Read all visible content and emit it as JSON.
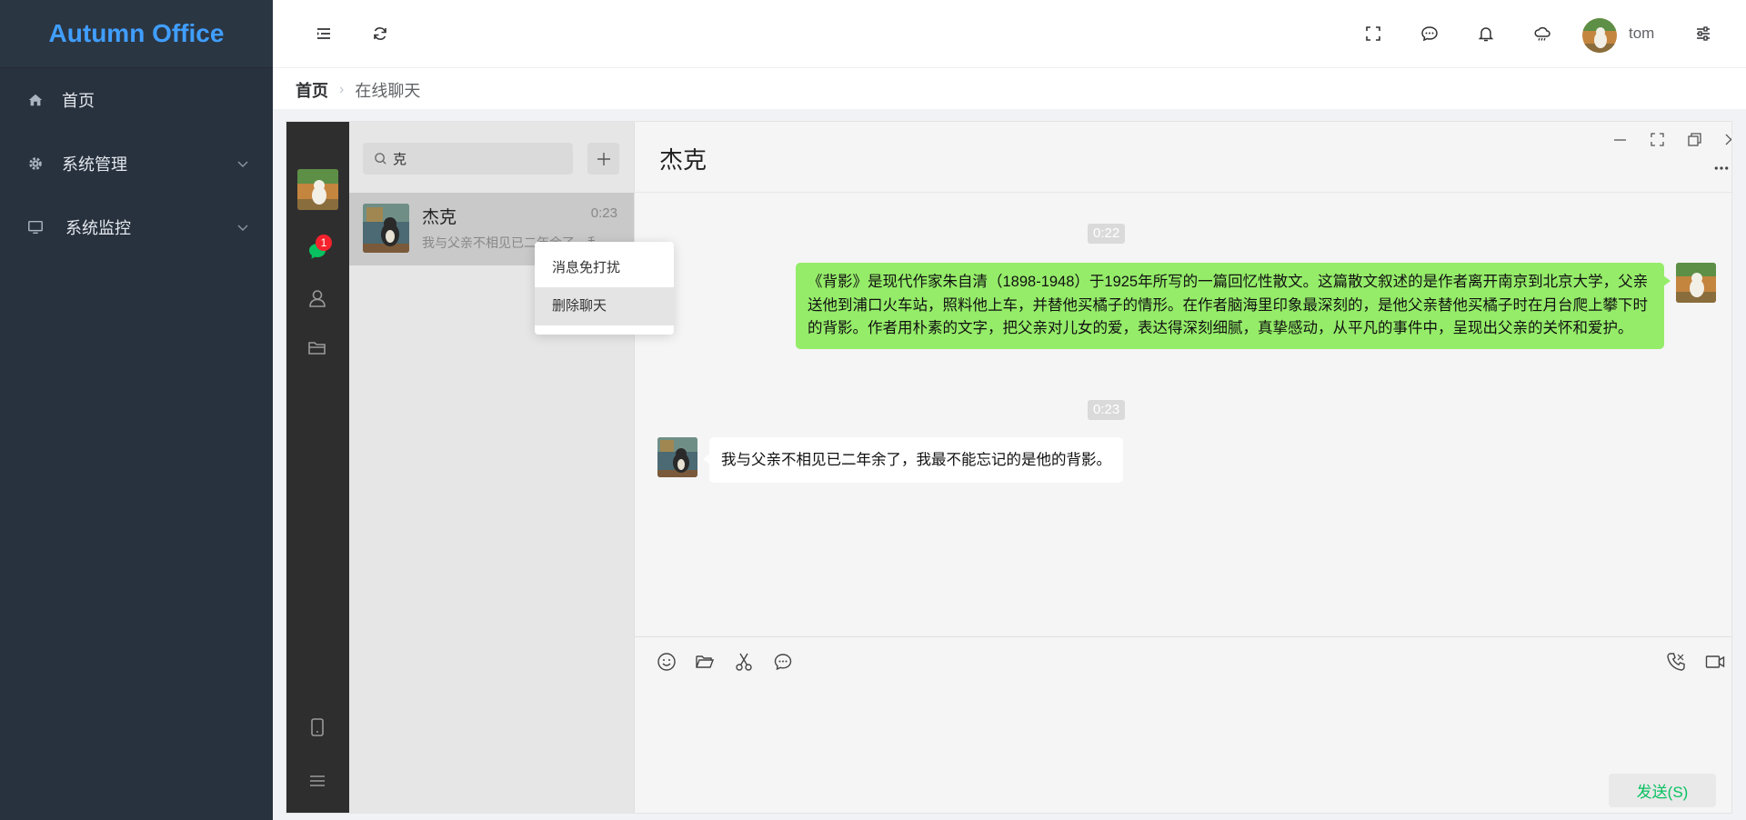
{
  "brand": {
    "title": "Autumn Office",
    "color": "#409eff"
  },
  "sidebar": {
    "items": [
      {
        "label": "首页",
        "icon": "home-icon"
      },
      {
        "label": "系统管理",
        "icon": "gear-icon",
        "expandable": true
      },
      {
        "label": "系统监控",
        "icon": "monitor-icon",
        "expandable": true
      }
    ]
  },
  "header": {
    "icons": [
      "menu-fold-icon",
      "refresh-icon",
      "fullscreen-icon",
      "chat-icon",
      "bell-icon",
      "weather-icon",
      "settings-sliders-icon"
    ],
    "username": "tom"
  },
  "breadcrumb": {
    "home": "首页",
    "current": "在线聊天"
  },
  "chat": {
    "unread_badge": "1",
    "search": {
      "value": "克",
      "placeholder": ""
    },
    "conversation": {
      "name": "杰克",
      "time": "0:23",
      "preview": "我与父亲不相见已二年余了，我最不能忘记的是他的背影。"
    },
    "context_menu": {
      "items": [
        "消息免打扰",
        "删除聊天"
      ]
    },
    "title": "杰克",
    "messages": [
      {
        "time": "0:22",
        "direction": "outgoing",
        "text": "《背影》是现代作家朱自清（1898-1948）于1925年所写的一篇回忆性散文。这篇散文叙述的是作者离开南京到北京大学，父亲送他到浦口火车站，照料他上车，并替他买橘子的情形。在作者脑海里印象最深刻的，是他父亲替他买橘子时在月台爬上攀下时的背影。作者用朴素的文字，把父亲对儿女的爱，表达得深刻细腻，真挚感动，从平凡的事件中，呈现出父亲的关怀和爱护。"
      },
      {
        "time": "0:23",
        "direction": "incoming",
        "text": "我与父亲不相见已二年余了，我最不能忘记的是他的背影。"
      }
    ],
    "send_label": "发送(S)",
    "colors": {
      "outgoing_bubble": "#95ec69",
      "send_text": "#07c160",
      "badge": "#f5222d"
    }
  }
}
